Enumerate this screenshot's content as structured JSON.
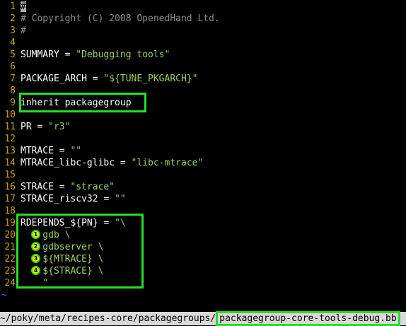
{
  "editor": {
    "lines": [
      {
        "n": "1",
        "parts": [
          {
            "t": "#",
            "c": "cursor"
          }
        ]
      },
      {
        "n": "2",
        "parts": [
          {
            "t": "# Copyright (C) 2008 OpenedHand Ltd.",
            "c": "cm"
          }
        ]
      },
      {
        "n": "3",
        "parts": [
          {
            "t": "#",
            "c": "cm"
          }
        ]
      },
      {
        "n": "4",
        "parts": []
      },
      {
        "n": "5",
        "parts": [
          {
            "t": "SUMMARY = ",
            "c": ""
          },
          {
            "t": "\"Debugging tools\"",
            "c": "str"
          }
        ]
      },
      {
        "n": "6",
        "parts": []
      },
      {
        "n": "7",
        "parts": [
          {
            "t": "PACKAGE_ARCH = ",
            "c": ""
          },
          {
            "t": "\"${TUNE_PKGARCH}\"",
            "c": "str"
          }
        ]
      },
      {
        "n": "8",
        "parts": []
      },
      {
        "n": "9",
        "parts": [
          {
            "t": "inherit packagegroup",
            "c": ""
          }
        ]
      },
      {
        "n": "10",
        "parts": []
      },
      {
        "n": "11",
        "parts": [
          {
            "t": "PR = ",
            "c": ""
          },
          {
            "t": "\"r3\"",
            "c": "str"
          }
        ]
      },
      {
        "n": "12",
        "parts": []
      },
      {
        "n": "13",
        "parts": [
          {
            "t": "MTRACE = ",
            "c": ""
          },
          {
            "t": "\"\"",
            "c": "str"
          }
        ]
      },
      {
        "n": "14",
        "parts": [
          {
            "t": "MTRACE_libc-glibc = ",
            "c": ""
          },
          {
            "t": "\"libc-mtrace\"",
            "c": "str"
          }
        ]
      },
      {
        "n": "15",
        "parts": []
      },
      {
        "n": "16",
        "parts": [
          {
            "t": "STRACE = ",
            "c": ""
          },
          {
            "t": "\"strace\"",
            "c": "str"
          }
        ]
      },
      {
        "n": "17",
        "parts": [
          {
            "t": "STRACE_riscv32 = ",
            "c": ""
          },
          {
            "t": "\"\"",
            "c": "str"
          }
        ]
      },
      {
        "n": "18",
        "parts": []
      },
      {
        "n": "19",
        "parts": [
          {
            "t": "RDEPENDS_${PN} = ",
            "c": ""
          },
          {
            "t": "\"\\",
            "c": "str"
          }
        ]
      },
      {
        "n": "20",
        "parts": [
          {
            "t": "    gdb \\",
            "c": "str"
          }
        ]
      },
      {
        "n": "21",
        "parts": [
          {
            "t": "    gdbserver \\",
            "c": "str"
          }
        ]
      },
      {
        "n": "22",
        "parts": [
          {
            "t": "    ${MTRACE} \\",
            "c": "str"
          }
        ]
      },
      {
        "n": "23",
        "parts": [
          {
            "t": "    ${STRACE} \\",
            "c": "str"
          }
        ]
      },
      {
        "n": "24",
        "parts": [
          {
            "t": "    \"",
            "c": "str"
          }
        ]
      }
    ],
    "tilde": "~",
    "callouts": [
      "1",
      "2",
      "3",
      "4"
    ]
  },
  "status": {
    "path": "~/poky/meta/recipes-core/packagegroups/",
    "filename": "packagegroup-core-tools-debug.bb"
  }
}
